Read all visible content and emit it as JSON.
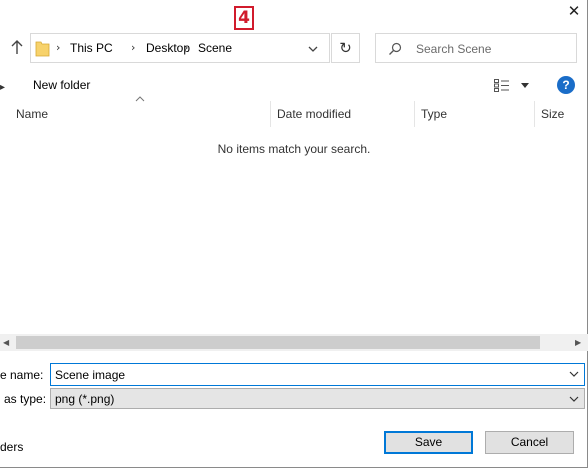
{
  "badge": "4",
  "breadcrumb": [
    "This PC",
    "Desktop",
    "Scene"
  ],
  "search": {
    "placeholder": "Search Scene"
  },
  "toolbar": {
    "new_folder": "New folder",
    "help": "?"
  },
  "columns": [
    "Name",
    "Date modified",
    "Type",
    "Size"
  ],
  "empty_message": "No items match your search.",
  "form": {
    "filename_label": "e name:",
    "filename_value": "Scene image",
    "type_label": "as type:",
    "type_value": "png (*.png)",
    "folders_label": "ders"
  },
  "buttons": {
    "save": "Save",
    "cancel": "Cancel"
  },
  "icons": {
    "close": "close-icon",
    "up": "arrow-up-icon",
    "folder": "folder-icon",
    "refresh": "refresh-icon",
    "search": "search-icon",
    "view": "view-options-icon",
    "help": "help-icon"
  },
  "colors": {
    "accent": "#0078d7",
    "badge": "#d11b2c",
    "help": "#1a6dc8"
  }
}
